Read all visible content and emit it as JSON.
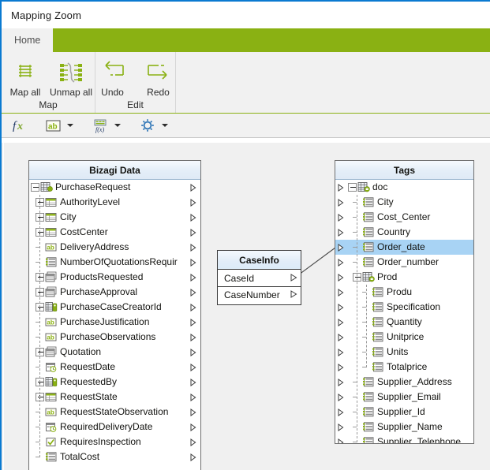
{
  "window": {
    "title": "Mapping Zoom"
  },
  "ribbon": {
    "tabs": [
      {
        "label": "Home",
        "active": true
      }
    ],
    "groups": [
      {
        "title": "Map",
        "buttons": [
          {
            "label": "Map all",
            "icon": "map-all-icon"
          },
          {
            "label": "Unmap all",
            "icon": "unmap-all-icon"
          }
        ]
      },
      {
        "title": "Edit",
        "buttons": [
          {
            "label": "Undo",
            "icon": "undo-icon"
          },
          {
            "label": "Redo",
            "icon": "redo-icon"
          }
        ]
      }
    ]
  },
  "toolbar": {
    "items": [
      {
        "name": "function-button",
        "icon": "fx-icon",
        "caret": false
      },
      {
        "name": "string-type-button",
        "icon": "ab-icon",
        "caret": true
      },
      {
        "name": "format-button",
        "icon": "format-icon",
        "caret": true
      },
      {
        "name": "settings-button",
        "icon": "gear-icon",
        "caret": true
      }
    ]
  },
  "colors": {
    "accent_green": "#8ab113",
    "window_border_blue": "#0a7ad1",
    "selection_blue": "#a8d3f4",
    "canvas_gray": "#f0f0f0",
    "icon_green": "#8ab113"
  },
  "left_panel": {
    "title": "Bizagi Data",
    "nodes": [
      {
        "label": "PurchaseRequest",
        "depth": 0,
        "expander": "minus",
        "icon": "entity-icon",
        "arrow": true
      },
      {
        "label": "AuthorityLevel",
        "depth": 1,
        "expander": "plus",
        "icon": "table-icon",
        "arrow": true
      },
      {
        "label": "City",
        "depth": 1,
        "expander": "plus",
        "icon": "table-icon",
        "arrow": true
      },
      {
        "label": "CostCenter",
        "depth": 1,
        "expander": "plus",
        "icon": "table-icon",
        "arrow": true
      },
      {
        "label": "DeliveryAddress",
        "depth": 1,
        "expander": "none",
        "icon": "string-icon",
        "arrow": true
      },
      {
        "label": "NumberOfQuotationsRequir",
        "depth": 1,
        "expander": "none",
        "icon": "number-icon",
        "arrow": true
      },
      {
        "label": "ProductsRequested",
        "depth": 1,
        "expander": "plus",
        "icon": "collection-icon",
        "arrow": true
      },
      {
        "label": "PurchaseApproval",
        "depth": 1,
        "expander": "plus",
        "icon": "collection-icon",
        "arrow": true
      },
      {
        "label": "PurchaseCaseCreatorId",
        "depth": 1,
        "expander": "plus",
        "icon": "person-icon",
        "arrow": true
      },
      {
        "label": "PurchaseJustification",
        "depth": 1,
        "expander": "none",
        "icon": "string-icon",
        "arrow": true
      },
      {
        "label": "PurchaseObservations",
        "depth": 1,
        "expander": "none",
        "icon": "string-icon",
        "arrow": true
      },
      {
        "label": "Quotation",
        "depth": 1,
        "expander": "plus",
        "icon": "collection-icon",
        "arrow": true
      },
      {
        "label": "RequestDate",
        "depth": 1,
        "expander": "none",
        "icon": "date-icon",
        "arrow": true
      },
      {
        "label": "RequestedBy",
        "depth": 1,
        "expander": "plus",
        "icon": "person-icon",
        "arrow": true
      },
      {
        "label": "RequestState",
        "depth": 1,
        "expander": "plus",
        "icon": "table-icon",
        "arrow": true
      },
      {
        "label": "RequestStateObservation",
        "depth": 1,
        "expander": "none",
        "icon": "string-icon",
        "arrow": true
      },
      {
        "label": "RequiredDeliveryDate",
        "depth": 1,
        "expander": "none",
        "icon": "date-icon",
        "arrow": true
      },
      {
        "label": "RequiresInspection",
        "depth": 1,
        "expander": "none",
        "icon": "boolean-icon",
        "arrow": true
      },
      {
        "label": "TotalCost",
        "depth": 1,
        "expander": "none",
        "icon": "number-icon",
        "arrow": true
      }
    ]
  },
  "right_panel": {
    "title": "Tags",
    "nodes": [
      {
        "label": "doc",
        "depth": 0,
        "expander": "minus",
        "icon": "xml-root-icon",
        "arrow": true,
        "selected": false
      },
      {
        "label": "City",
        "depth": 1,
        "expander": "none",
        "icon": "element-icon",
        "arrow": true,
        "selected": false
      },
      {
        "label": "Cost_Center",
        "depth": 1,
        "expander": "none",
        "icon": "element-icon",
        "arrow": true,
        "selected": false
      },
      {
        "label": "Country",
        "depth": 1,
        "expander": "none",
        "icon": "element-icon",
        "arrow": true,
        "selected": false
      },
      {
        "label": "Order_date",
        "depth": 1,
        "expander": "none",
        "icon": "element-icon",
        "arrow": true,
        "selected": true
      },
      {
        "label": "Order_number",
        "depth": 1,
        "expander": "none",
        "icon": "element-icon",
        "arrow": true,
        "selected": false
      },
      {
        "label": "Prod",
        "depth": 1,
        "expander": "minus",
        "icon": "xml-root-icon",
        "arrow": true,
        "selected": false
      },
      {
        "label": "Produ",
        "depth": 2,
        "expander": "none",
        "icon": "element-icon",
        "arrow": true,
        "selected": false
      },
      {
        "label": "Specification",
        "depth": 2,
        "expander": "none",
        "icon": "element-icon",
        "arrow": true,
        "selected": false
      },
      {
        "label": "Quantity",
        "depth": 2,
        "expander": "none",
        "icon": "element-icon",
        "arrow": true,
        "selected": false
      },
      {
        "label": "Unitprice",
        "depth": 2,
        "expander": "none",
        "icon": "element-icon",
        "arrow": true,
        "selected": false
      },
      {
        "label": "Units",
        "depth": 2,
        "expander": "none",
        "icon": "element-icon",
        "arrow": true,
        "selected": false
      },
      {
        "label": "Totalprice",
        "depth": 2,
        "expander": "none",
        "icon": "element-icon",
        "arrow": true,
        "selected": false
      },
      {
        "label": "Supplier_Address",
        "depth": 1,
        "expander": "none",
        "icon": "element-icon",
        "arrow": true,
        "selected": false
      },
      {
        "label": "Supplier_Email",
        "depth": 1,
        "expander": "none",
        "icon": "element-icon",
        "arrow": true,
        "selected": false
      },
      {
        "label": "Supplier_Id",
        "depth": 1,
        "expander": "none",
        "icon": "element-icon",
        "arrow": true,
        "selected": false
      },
      {
        "label": "Supplier_Name",
        "depth": 1,
        "expander": "none",
        "icon": "element-icon",
        "arrow": true,
        "selected": false
      },
      {
        "label": "Supplier_Telephone",
        "depth": 1,
        "expander": "none",
        "icon": "element-icon",
        "arrow": true,
        "selected": false
      }
    ]
  },
  "case_info_node": {
    "title": "CaseInfo",
    "rows": [
      {
        "label": "CaseId"
      },
      {
        "label": "CaseNumber"
      }
    ]
  },
  "mapping_link": {
    "from": "CaseId",
    "to": "Order_date"
  }
}
